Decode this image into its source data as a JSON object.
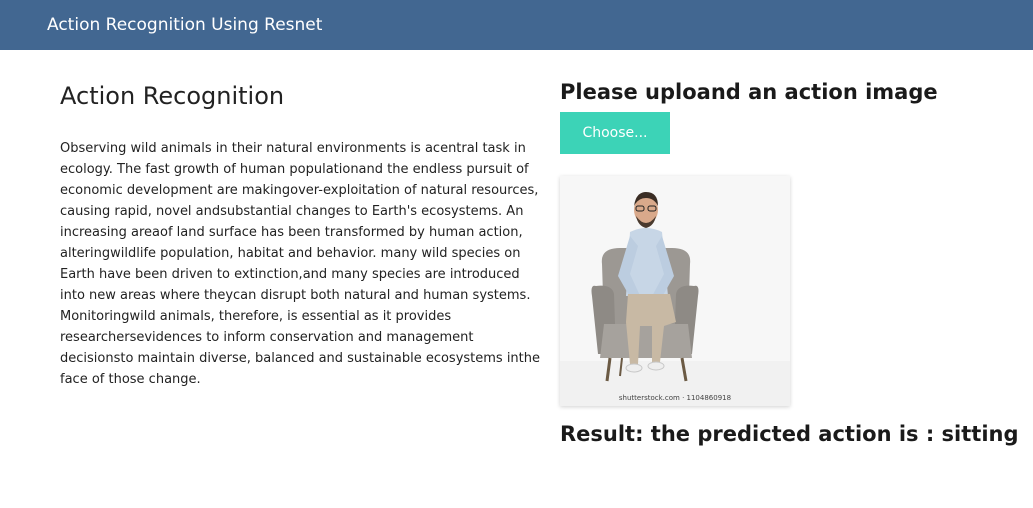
{
  "navbar": {
    "brand": "Action Recognition Using Resnet"
  },
  "intro": {
    "title": "Action Recognition",
    "body": "Observing wild animals in their natural environments is acentral task in ecology. The fast growth of human populationand the endless pursuit of economic development are makingover-exploitation of natural resources, causing rapid, novel andsubstantial changes to Earth's ecosystems. An increasing areaof land surface has been transformed by human action, alteringwildlife population, habitat and behavior. many wild species on Earth have been driven to extinction,and many species are introduced into new areas where theycan disrupt both natural and human systems. Monitoringwild animals, therefore, is essential as it provides researchersevidences to inform conservation and management decisionsto maintain diverse, balanced and sustainable ecosystems inthe face of those change."
  },
  "upload": {
    "heading": "Please uploand an action image",
    "button_label": "Choose...",
    "image_caption": "shutterstock.com · 1104860918"
  },
  "result": {
    "text": "Result: the predicted action is : sitting"
  },
  "colors": {
    "navbar": "#426791",
    "button": "#3cd3b7",
    "result": "#2f4a6a"
  }
}
